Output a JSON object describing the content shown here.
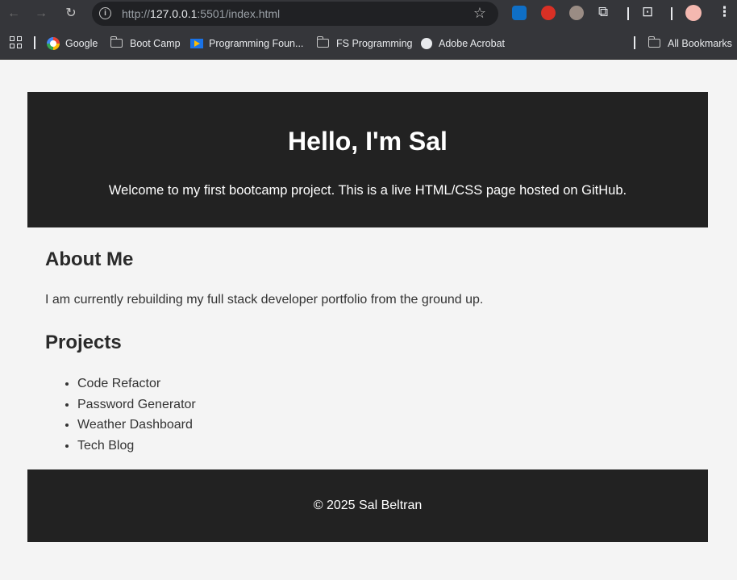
{
  "browser": {
    "url_scheme": "http://",
    "url_host": "127.0.0.1",
    "url_rest": ":5501/index.html",
    "bookmarks": [
      {
        "label": "Google",
        "icon": "google-icon"
      },
      {
        "label": "Boot Camp",
        "icon": "folder-icon"
      },
      {
        "label": "Programming Foun...",
        "icon": "play-icon"
      },
      {
        "label": "FS Programming",
        "icon": "folder-icon"
      },
      {
        "label": "Adobe Acrobat",
        "icon": "globe-icon"
      }
    ],
    "all_bookmarks_label": "All Bookmarks"
  },
  "header": {
    "title": "Hello, I'm Sal",
    "subtitle": "Welcome to my first bootcamp project. This is a live HTML/CSS page hosted on GitHub."
  },
  "about": {
    "title": "About Me",
    "text": "I am currently rebuilding my full stack developer portfolio from the ground up."
  },
  "projects": {
    "title": "Projects",
    "items": [
      "Code Refactor",
      "Password Generator",
      "Weather Dashboard",
      "Tech Blog"
    ]
  },
  "footer": {
    "text": "© 2025 Sal Beltran"
  },
  "colors": {
    "page_bg": "#f4f4f4",
    "header_bg": "#222222",
    "chrome_bg": "#35363a"
  }
}
